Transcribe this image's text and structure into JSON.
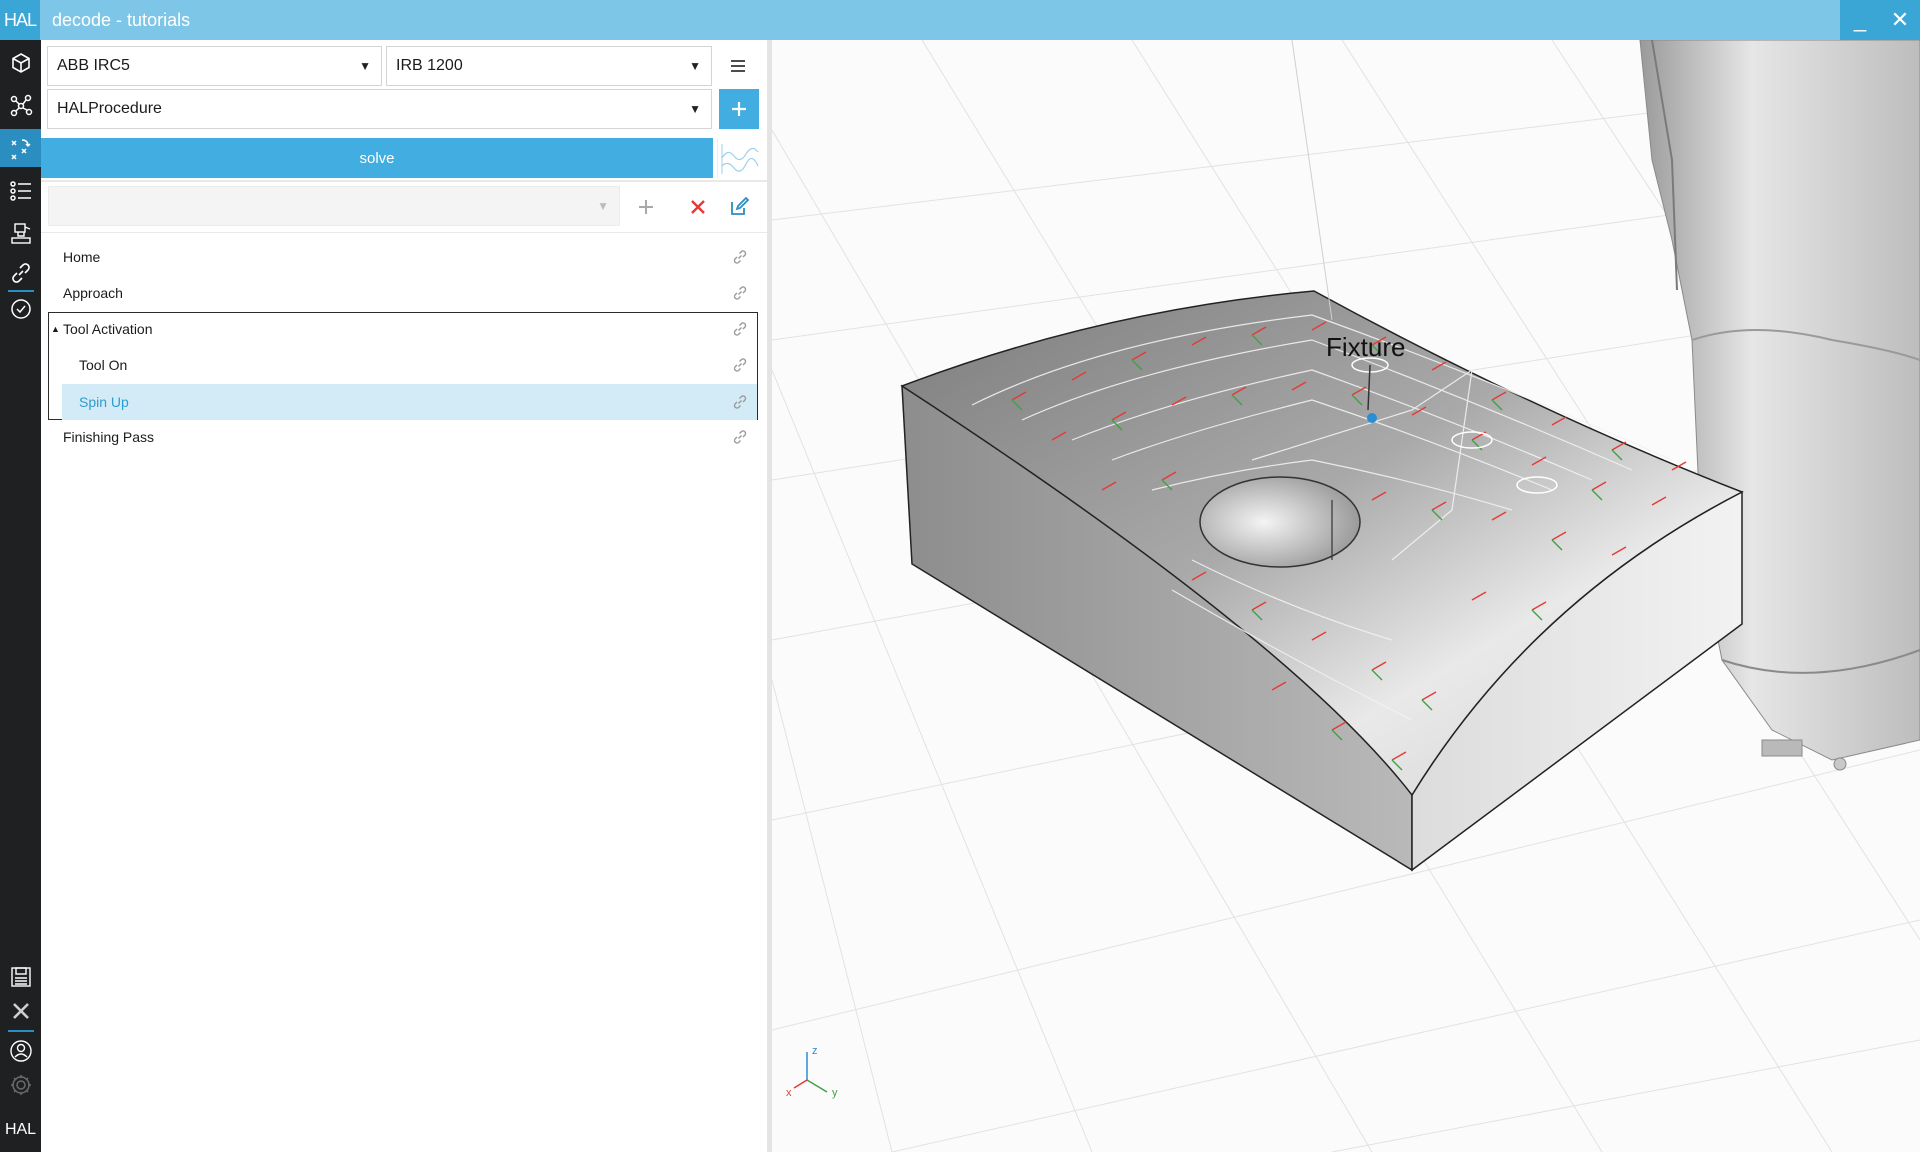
{
  "window": {
    "logo": "HAL",
    "title": "decode - tutorials",
    "minimize": "_",
    "close": "✕"
  },
  "rail": {
    "icons": [
      "cell-icon",
      "network-icon",
      "procedure-icon",
      "list-icon",
      "robot-icon",
      "link-icon",
      "check-icon",
      "save-icon",
      "close-icon",
      "user-icon",
      "settings-icon"
    ],
    "bottom_logo": "HAL",
    "accent": "#2a8ec0"
  },
  "panel": {
    "controller_select": "ABB IRC5",
    "robot_select": "IRB 1200",
    "procedure_select": "HALProcedure",
    "solve_label": "solve",
    "accent": "#41ade0"
  },
  "tree": {
    "items": [
      {
        "label": "Home"
      },
      {
        "label": "Approach"
      },
      {
        "label": "Tool Activation",
        "expanded": true
      },
      {
        "label": "Tool On"
      },
      {
        "label": "Spin Up",
        "selected": true
      },
      {
        "label": "Finishing Pass"
      }
    ]
  },
  "viewport": {
    "label": "Fixture",
    "axes": {
      "x": "x",
      "y": "y",
      "z": "z"
    }
  }
}
